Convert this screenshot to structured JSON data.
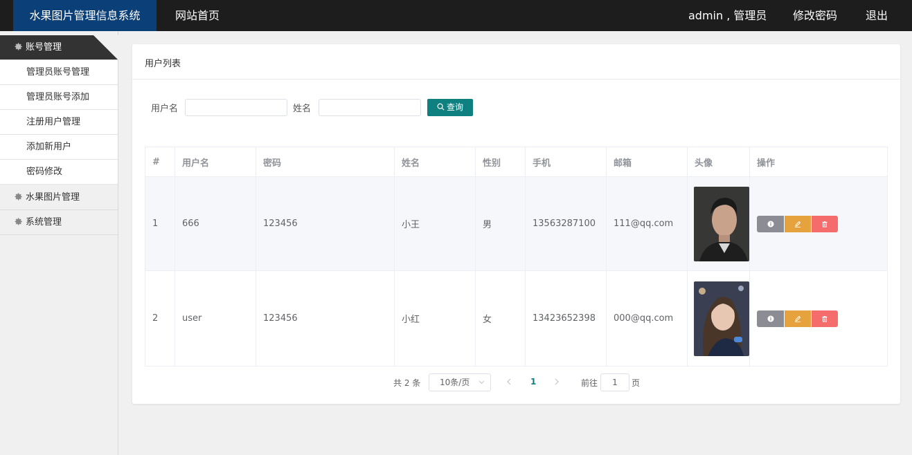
{
  "header": {
    "brand": "水果图片管理信息系统",
    "home": "网站首页",
    "user": "admin , 管理员",
    "change_password": "修改密码",
    "logout": "退出"
  },
  "sidebar": {
    "groups": [
      {
        "label": "账号管理",
        "active": true
      },
      {
        "label": "水果图片管理",
        "active": false
      },
      {
        "label": "系统管理",
        "active": false
      }
    ],
    "account_items": [
      "管理员账号管理",
      "管理员账号添加",
      "注册用户管理",
      "添加新用户",
      "密码修改"
    ]
  },
  "main": {
    "card_title": "用户列表",
    "search": {
      "username_label": "用户名",
      "username_value": "",
      "name_label": "姓名",
      "name_value": "",
      "search_button": "查询"
    },
    "table": {
      "headers": [
        "#",
        "用户名",
        "密码",
        "姓名",
        "性别",
        "手机",
        "邮箱",
        "头像",
        "操作"
      ],
      "rows": [
        {
          "index": "1",
          "username": "666",
          "password": "123456",
          "name": "小王",
          "gender": "男",
          "phone": "13563287100",
          "email": "111@qq.com",
          "avatar": "male-portrait"
        },
        {
          "index": "2",
          "username": "user",
          "password": "123456",
          "name": "小红",
          "gender": "女",
          "phone": "13423652398",
          "email": "000@qq.com",
          "avatar": "female-portrait"
        }
      ]
    },
    "pagination": {
      "total": "共 2 条",
      "page_size": "10条/页",
      "current_page": "1",
      "goto_label": "前往",
      "goto_value": "1",
      "page_unit": "页"
    }
  },
  "colors": {
    "topbar": "#1d1d1d",
    "brand": "#0b3f78",
    "primary": "#0e8080",
    "info": "#8c8c94",
    "warning": "#e6a23c",
    "danger": "#f56c6c"
  }
}
